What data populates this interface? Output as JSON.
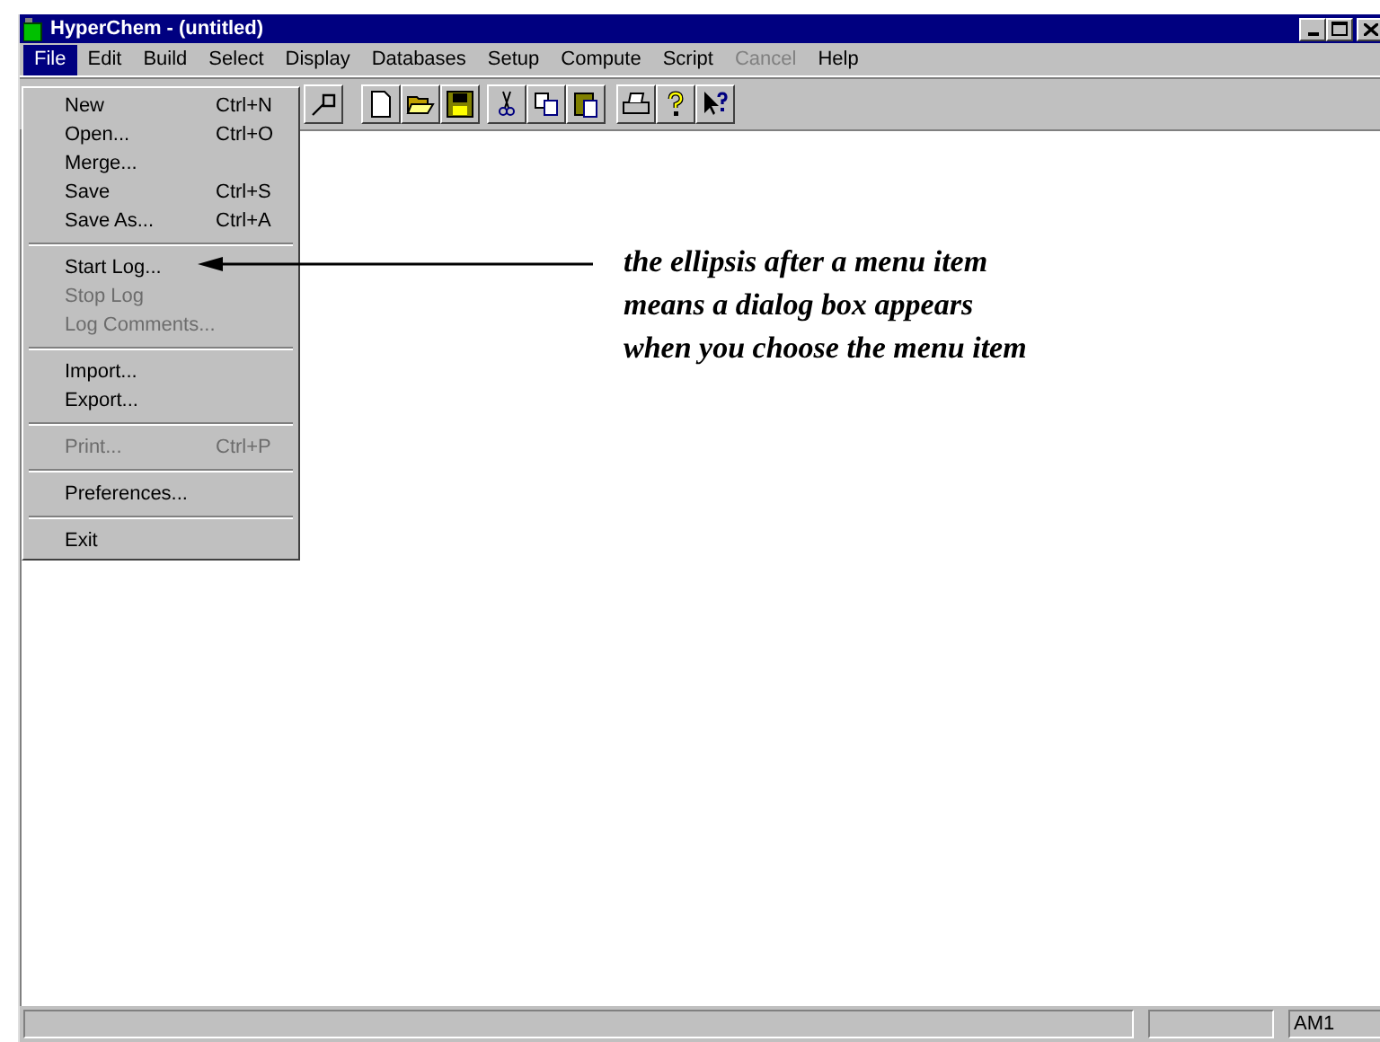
{
  "window": {
    "title": "HyperChem - (untitled)"
  },
  "menu_bar": [
    {
      "label": "File",
      "selected": true,
      "disabled": false
    },
    {
      "label": "Edit",
      "selected": false,
      "disabled": false
    },
    {
      "label": "Build",
      "selected": false,
      "disabled": false
    },
    {
      "label": "Select",
      "selected": false,
      "disabled": false
    },
    {
      "label": "Display",
      "selected": false,
      "disabled": false
    },
    {
      "label": "Databases",
      "selected": false,
      "disabled": false
    },
    {
      "label": "Setup",
      "selected": false,
      "disabled": false
    },
    {
      "label": "Compute",
      "selected": false,
      "disabled": false
    },
    {
      "label": "Script",
      "selected": false,
      "disabled": false
    },
    {
      "label": "Cancel",
      "selected": false,
      "disabled": true
    },
    {
      "label": "Help",
      "selected": false,
      "disabled": false
    }
  ],
  "file_menu": [
    [
      {
        "label": "New",
        "shortcut": "Ctrl+N",
        "disabled": false
      },
      {
        "label": "Open...",
        "shortcut": "Ctrl+O",
        "disabled": false
      },
      {
        "label": "Merge...",
        "disabled": false
      },
      {
        "label": "Save",
        "shortcut": "Ctrl+S",
        "disabled": false
      },
      {
        "label": "Save As...",
        "shortcut": "Ctrl+A",
        "disabled": false
      }
    ],
    [
      {
        "label": "Start Log...",
        "disabled": false
      },
      {
        "label": "Stop Log",
        "disabled": true
      },
      {
        "label": "Log Comments...",
        "disabled": true
      }
    ],
    [
      {
        "label": "Import...",
        "disabled": false
      },
      {
        "label": "Export...",
        "disabled": false
      }
    ],
    [
      {
        "label": "Print...",
        "shortcut": "Ctrl+P",
        "disabled": true
      }
    ],
    [
      {
        "label": "Preferences...",
        "disabled": false
      }
    ],
    [
      {
        "label": "Exit",
        "disabled": false
      }
    ]
  ],
  "annotation": {
    "lines": [
      "the ellipsis after a menu item",
      "means a dialog box appears",
      "when you choose the menu item"
    ]
  },
  "status_bar": {
    "panel_3": "AM1"
  }
}
